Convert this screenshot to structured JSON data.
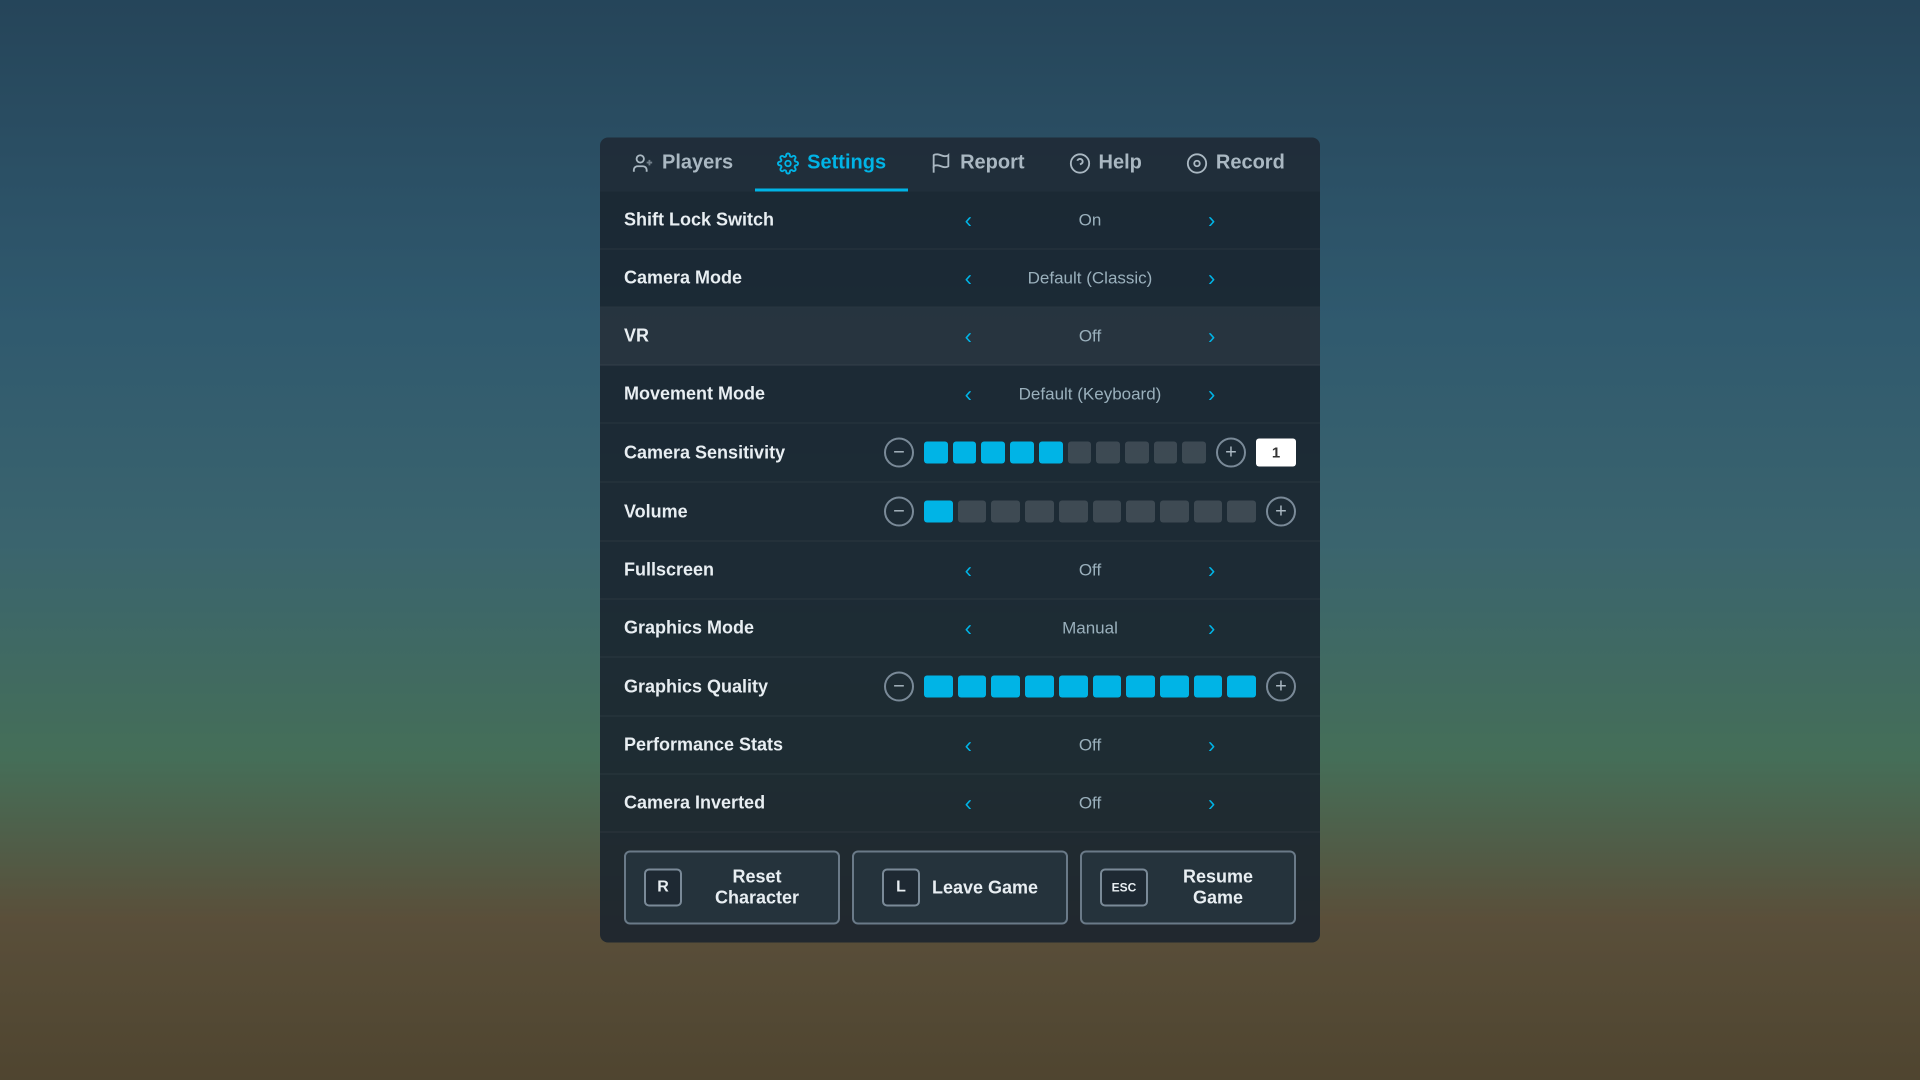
{
  "background": {
    "overlay_opacity": 0.35
  },
  "tabs": [
    {
      "id": "players",
      "label": "Players",
      "icon": "👤",
      "active": false
    },
    {
      "id": "settings",
      "label": "Settings",
      "icon": "⚙️",
      "active": true
    },
    {
      "id": "report",
      "label": "Report",
      "icon": "🚩",
      "active": false
    },
    {
      "id": "help",
      "label": "Help",
      "icon": "❓",
      "active": false
    },
    {
      "id": "record",
      "label": "Record",
      "icon": "⊙",
      "active": false
    }
  ],
  "settings": [
    {
      "id": "shift-lock",
      "label": "Shift Lock Switch",
      "type": "toggle",
      "value": "On",
      "highlighted": false
    },
    {
      "id": "camera-mode",
      "label": "Camera Mode",
      "type": "toggle",
      "value": "Default (Classic)",
      "highlighted": false
    },
    {
      "id": "vr",
      "label": "VR",
      "type": "toggle",
      "value": "Off",
      "highlighted": true
    },
    {
      "id": "movement-mode",
      "label": "Movement Mode",
      "type": "toggle",
      "value": "Default (Keyboard)",
      "highlighted": false
    },
    {
      "id": "camera-sensitivity",
      "label": "Camera Sensitivity",
      "type": "slider",
      "filled_blocks": 5,
      "total_blocks": 10,
      "slider_value": "1",
      "highlighted": false
    },
    {
      "id": "volume",
      "label": "Volume",
      "type": "slider",
      "filled_blocks": 1,
      "total_blocks": 10,
      "slider_value": null,
      "highlighted": false
    },
    {
      "id": "fullscreen",
      "label": "Fullscreen",
      "type": "toggle",
      "value": "Off",
      "highlighted": false
    },
    {
      "id": "graphics-mode",
      "label": "Graphics Mode",
      "type": "toggle",
      "value": "Manual",
      "highlighted": false
    },
    {
      "id": "graphics-quality",
      "label": "Graphics Quality",
      "type": "slider",
      "filled_blocks": 10,
      "total_blocks": 10,
      "slider_value": null,
      "highlighted": false
    },
    {
      "id": "performance-stats",
      "label": "Performance Stats",
      "type": "toggle",
      "value": "Off",
      "highlighted": false
    },
    {
      "id": "camera-inverted",
      "label": "Camera Inverted",
      "type": "toggle",
      "value": "Off",
      "highlighted": false
    }
  ],
  "bottom_buttons": [
    {
      "id": "reset",
      "key": "R",
      "label": "Reset Character"
    },
    {
      "id": "leave",
      "key": "L",
      "label": "Leave Game"
    },
    {
      "id": "resume",
      "key": "ESC",
      "label": "Resume Game"
    }
  ],
  "colors": {
    "active_tab": "#00b4e6",
    "filled_block": "#00b4e6",
    "empty_block": "rgba(255,255,255,0.15)"
  }
}
